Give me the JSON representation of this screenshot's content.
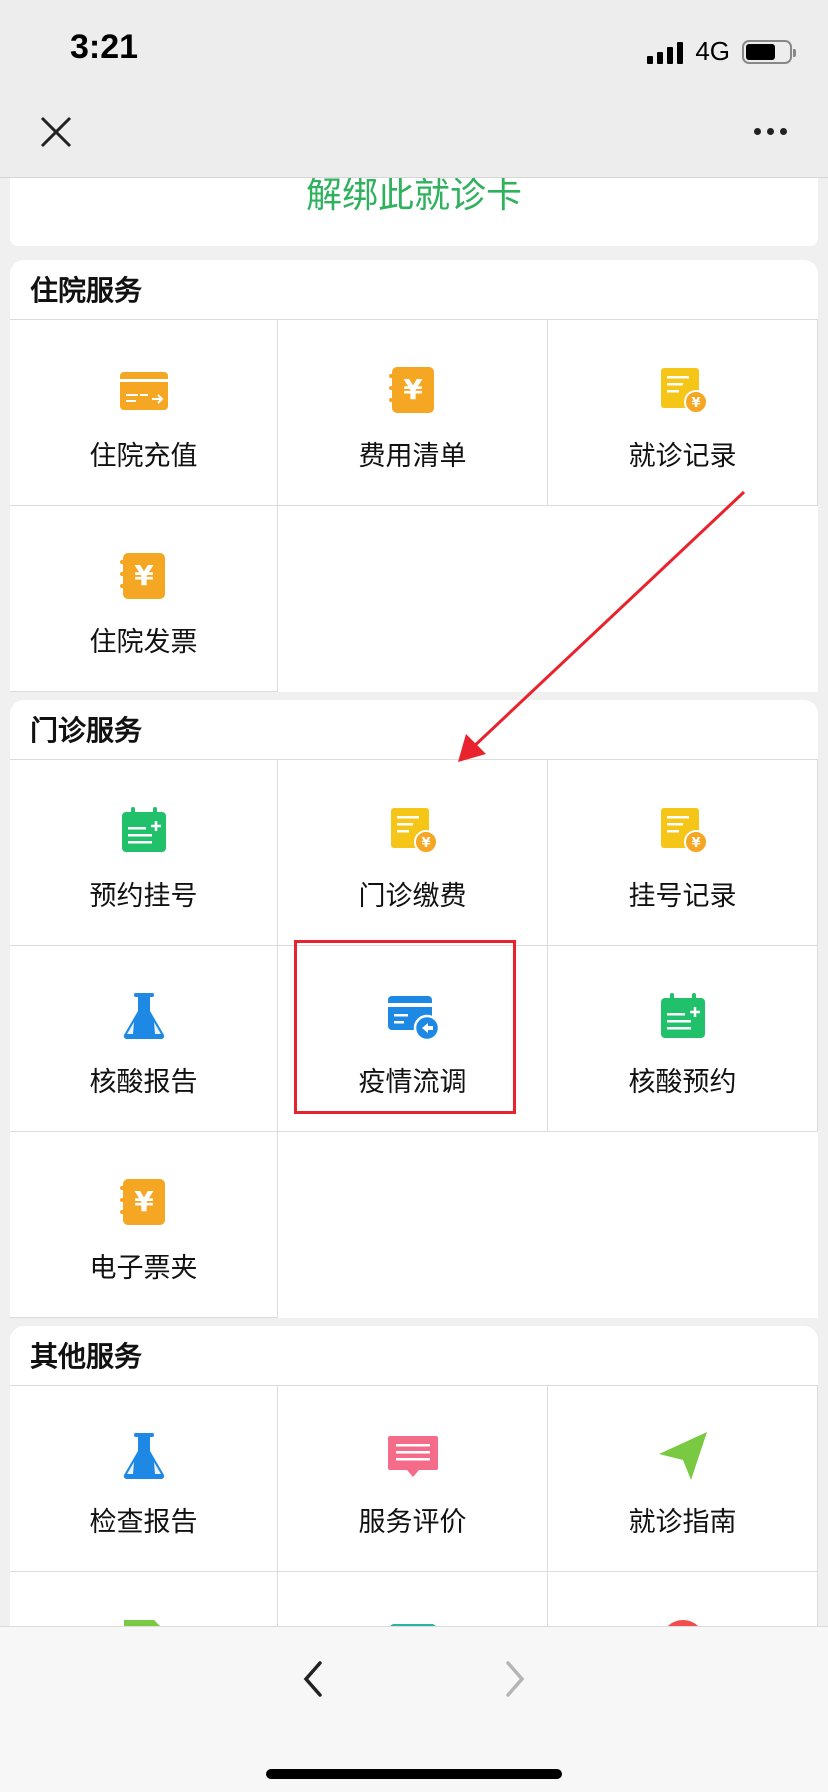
{
  "status": {
    "time": "3:21",
    "network": "4G"
  },
  "unbind_label": "解绑此就诊卡",
  "sections": {
    "inpatient": {
      "title": "住院服务",
      "items": [
        "住院充值",
        "费用清单",
        "就诊记录",
        "住院发票"
      ]
    },
    "outpatient": {
      "title": "门诊服务",
      "items": [
        "预约挂号",
        "门诊缴费",
        "挂号记录",
        "核酸报告",
        "疫情流调",
        "核酸预约",
        "电子票夹"
      ]
    },
    "other": {
      "title": "其他服务",
      "items": [
        "检查报告",
        "服务评价",
        "就诊指南"
      ]
    }
  },
  "colors": {
    "orange": "#f5a623",
    "green": "#21c16b",
    "blue": "#1e88e5",
    "pink": "#f56c8a",
    "lime": "#7ac943",
    "red": "#e8232d",
    "unbind_green": "#2fb15e"
  }
}
